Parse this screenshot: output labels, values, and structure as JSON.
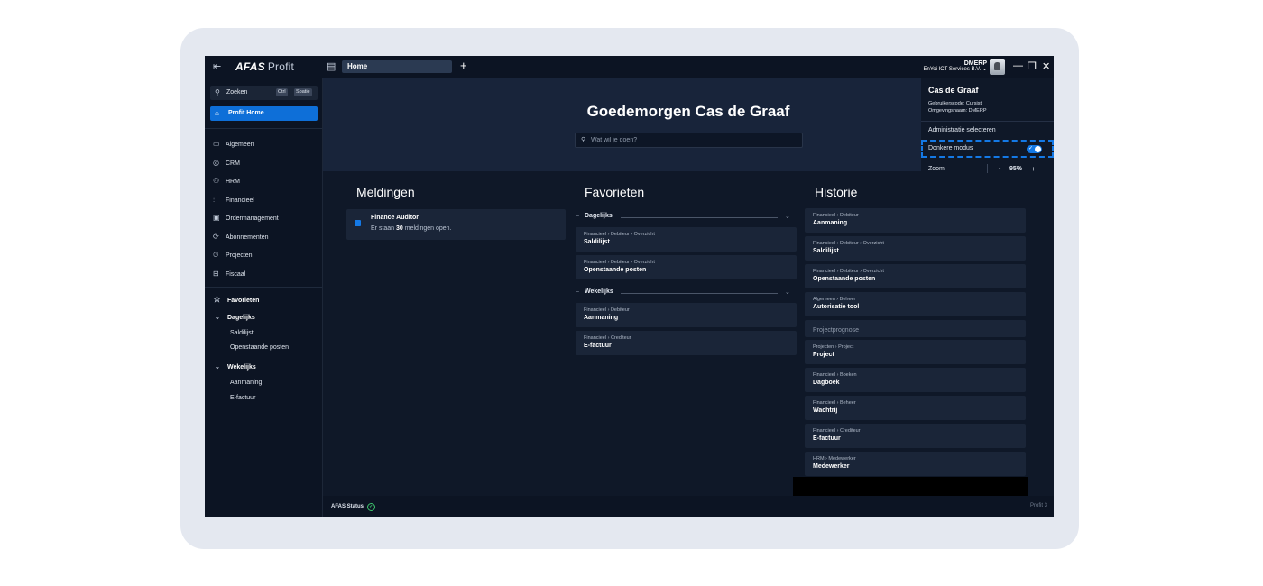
{
  "app": {
    "brand": "AFAS",
    "brand_sub": "Profit",
    "tab_home": "Home",
    "tab_add": "+",
    "env_code": "DMERP",
    "env_org": "EnYoi ICT Services B.V.",
    "env_chevron": "⌄",
    "minimize": "—",
    "maximize": "❐",
    "close": "✕"
  },
  "sidebar": {
    "search_label": "Zoeken",
    "kbd_ctrl": "Ctrl",
    "kbd_space": "Spatie",
    "home": "Profit Home",
    "items": [
      {
        "label": "Algemeen",
        "icon": "window-icon"
      },
      {
        "label": "CRM",
        "icon": "target-icon"
      },
      {
        "label": "HRM",
        "icon": "people-icon"
      },
      {
        "label": "Financieel",
        "icon": "chart-icon"
      },
      {
        "label": "Ordermanagement",
        "icon": "clipboard-icon"
      },
      {
        "label": "Abonnementen",
        "icon": "sync-icon"
      },
      {
        "label": "Projecten",
        "icon": "timer-icon"
      },
      {
        "label": "Fiscaal",
        "icon": "briefcase-icon"
      }
    ],
    "favorites": "Favorieten",
    "groups": [
      {
        "label": "Dagelijks",
        "links": [
          "Saldilijst",
          "Openstaande posten"
        ]
      },
      {
        "label": "Wekelijks",
        "links": [
          "Aanmaning",
          "E-factuur"
        ]
      }
    ]
  },
  "main": {
    "greeting": "Goedemorgen Cas de Graaf",
    "search_placeholder": "Wat wil je doen?"
  },
  "meldingen": {
    "title": "Meldingen",
    "item_title": "Finance Auditor",
    "item_pre": "Er staan ",
    "item_count": "30",
    "item_post": " meldingen open."
  },
  "favorieten": {
    "title": "Favorieten",
    "groups": [
      {
        "label": "Dagelijks",
        "cards": [
          {
            "crumb": "Financieel  ›  Debiteur  ›  Overzicht",
            "title": "Saldilijst"
          },
          {
            "crumb": "Financieel  ›  Debiteur  ›  Overzicht",
            "title": "Openstaande posten"
          }
        ]
      },
      {
        "label": "Wekelijks",
        "cards": [
          {
            "crumb": "Financieel  ›  Debiteur",
            "title": "Aanmaning"
          },
          {
            "crumb": "Financieel  ›  Crediteur",
            "title": "E-factuur"
          }
        ]
      }
    ]
  },
  "historie": {
    "title": "Historie",
    "items": [
      {
        "crumb": "Financieel  ›  Debiteur",
        "title": "Aanmaning"
      },
      {
        "crumb": "Financieel  ›  Debiteur  ›  Overzicht",
        "title": "Saldilijst"
      },
      {
        "crumb": "Financieel  ›  Debiteur  ›  Overzicht",
        "title": "Openstaande posten"
      },
      {
        "crumb": "Algemeen  ›  Beheer",
        "title": "Autorisatie tool"
      },
      {
        "crumb": "",
        "title": "Projectprognose"
      },
      {
        "crumb": "Projecten  ›  Project",
        "title": "Project"
      },
      {
        "crumb": "Financieel  ›  Boeken",
        "title": "Dagboek"
      },
      {
        "crumb": "Financieel  ›  Beheer",
        "title": "Wachtrij"
      },
      {
        "crumb": "Financieel  ›  Crediteur",
        "title": "E-factuur"
      },
      {
        "crumb": "HRM  ›  Medewerker",
        "title": "Medewerker"
      }
    ]
  },
  "profile": {
    "name": "Cas de Graaf",
    "user_code": "Gebruikerscode: Cursist",
    "env_name": "Omgevingsnaam: DMERP",
    "admin": "Administratie selecteren",
    "dark_mode": "Donkere modus",
    "dark_mode_on": true,
    "zoom_label": "Zoom",
    "zoom_minus": "-",
    "zoom_value": "95%",
    "zoom_plus": "+"
  },
  "status": {
    "left": "AFAS Status",
    "right": "Profit 3"
  },
  "colors": {
    "accent": "#0e6fd8",
    "background": "#0f1828",
    "card": "#1a2538"
  }
}
